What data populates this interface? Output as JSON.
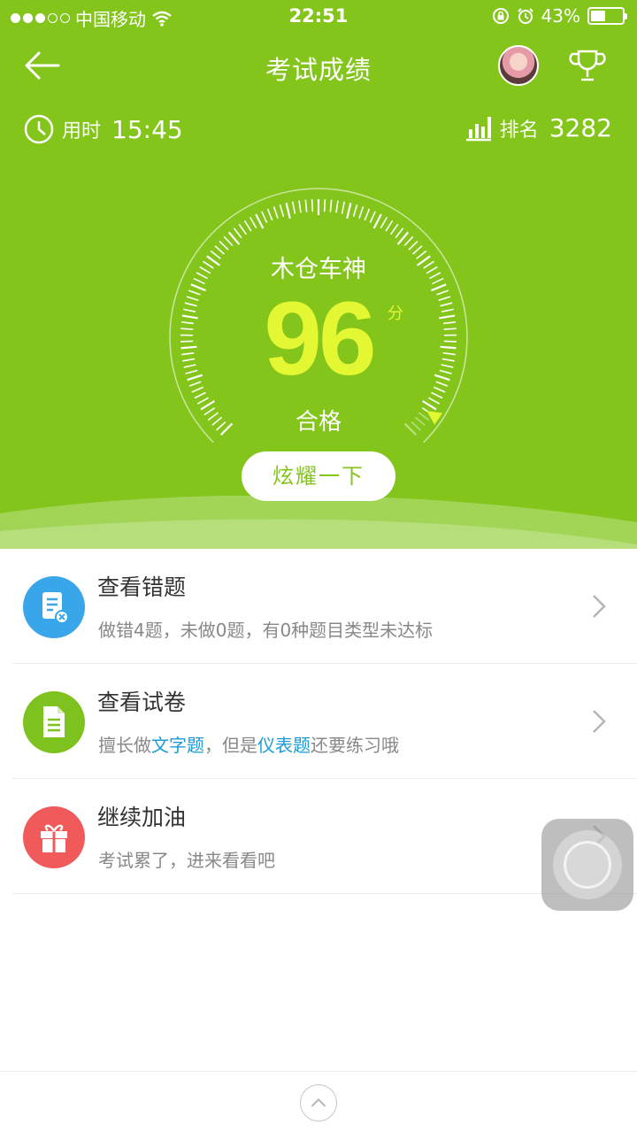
{
  "status_bar": {
    "carrier": "中国移动",
    "time": "22:51",
    "battery": "43%",
    "battery_level": 0.43
  },
  "nav": {
    "title": "考试成绩"
  },
  "stats": {
    "time_label": "用时",
    "time_value": "15:45",
    "rank_label": "排名",
    "rank_value": "3282"
  },
  "result": {
    "title_name": "木仓车神",
    "score": "96",
    "unit": "分",
    "verdict": "合格",
    "score_fraction": 0.96
  },
  "share_button": "炫耀一下",
  "list": [
    {
      "title": "查看错题",
      "subtitle": "做错4题，未做0题，有0种题目类型未达标",
      "icon": "wrong-answers-icon",
      "color": "#3aa6ea"
    },
    {
      "title": "查看试卷",
      "subtitle_parts": [
        "擅长做",
        "文字题",
        "，但是",
        "仪表题",
        "还要练习哦"
      ],
      "icon": "exam-paper-icon",
      "color": "#7dc21e"
    },
    {
      "title": "继续加油",
      "subtitle": "考试累了，进来看看吧",
      "icon": "gift-icon",
      "color": "#f05a5a"
    }
  ],
  "colors": {
    "header_green": "#83c51b",
    "score_yellow": "#e4f733",
    "highlight_blue": "#1c9bd8"
  }
}
